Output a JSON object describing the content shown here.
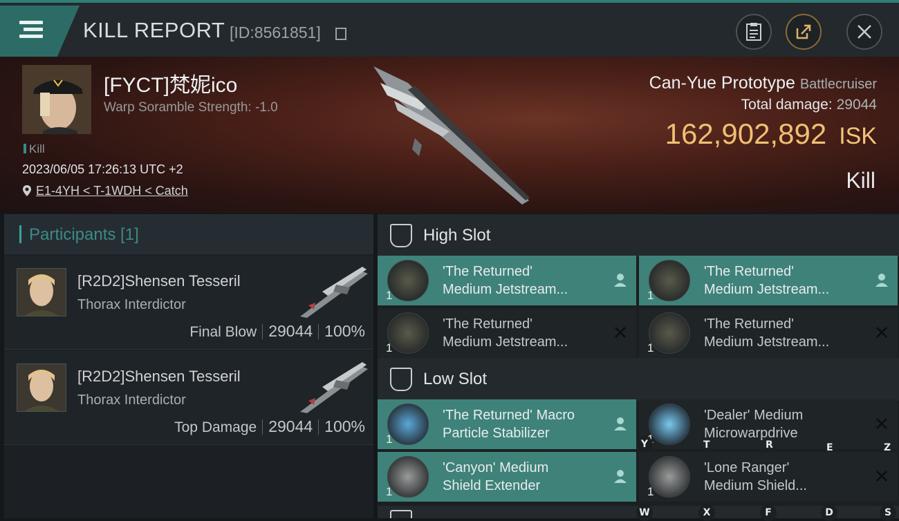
{
  "header": {
    "title": "KILL REPORT",
    "report_id": "[ID:8561851]"
  },
  "victim": {
    "name": "[FYCT]梵妮ico",
    "warp_scramble": "Warp Soramble Strength: -1.0",
    "tag": "Kill",
    "datetime": "2023/06/05 17:26:13 UTC +2",
    "location": "E1-4YH < T-1WDH < Catch",
    "ship_name": "Can-Yue Prototype",
    "ship_class": "Battlecruiser",
    "total_damage_label": "Total damage:",
    "total_damage_value": "29044",
    "isk_value": "162,902,892",
    "isk_unit": "ISK",
    "result": "Kill"
  },
  "participants": {
    "header": "Participants [1]",
    "rows": [
      {
        "name": "[R2D2]Shensen Tesseril",
        "ship": "Thorax Interdictor",
        "role": "Final Blow",
        "damage": "29044",
        "percent": "100%"
      },
      {
        "name": "[R2D2]Shensen Tesseril",
        "ship": "Thorax Interdictor",
        "role": "Top Damage",
        "damage": "29044",
        "percent": "100%"
      }
    ]
  },
  "slots": {
    "high": {
      "label": "High Slot",
      "modules": [
        {
          "line1": "'The Returned'",
          "line2": "Medium Jetstream...",
          "count": "1",
          "status": "fitted"
        },
        {
          "line1": "'The Returned'",
          "line2": "Medium Jetstream...",
          "count": "1",
          "status": "fitted"
        },
        {
          "line1": "'The Returned'",
          "line2": "Medium Jetstream...",
          "count": "1",
          "status": "destroyed"
        },
        {
          "line1": "'The Returned'",
          "line2": "Medium Jetstream...",
          "count": "1",
          "status": "destroyed"
        }
      ]
    },
    "low": {
      "label": "Low Slot",
      "modules": [
        {
          "line1": "'The Returned' Macro",
          "line2": "Particle Stabilizer",
          "count": "1",
          "status": "fitted"
        },
        {
          "line1": "'Dealer' Medium",
          "line2": "Microwarpdrive",
          "count": "1",
          "status": "destroyed"
        },
        {
          "line1": "'Canyon' Medium",
          "line2": "Shield Extender",
          "count": "1",
          "status": "fitted"
        },
        {
          "line1": "'Lone Ranger'",
          "line2": "Medium Shield...",
          "count": "1",
          "status": "destroyed"
        }
      ]
    }
  },
  "hotkeys": {
    "row1": [
      "Y",
      "T",
      "R",
      "E",
      "Z"
    ],
    "row2": [
      "W",
      "X",
      "F",
      "D",
      "S"
    ]
  },
  "colors": {
    "accent": "#3e8279",
    "isk": "#f0c072",
    "destroyed_bg": "#1f2427"
  },
  "icons": [
    "menu-icon",
    "copy-icon",
    "clipboard-icon",
    "share-icon",
    "close-icon",
    "location-pin-icon",
    "fitted-person-icon",
    "destroyed-x-icon",
    "slot-icon"
  ]
}
